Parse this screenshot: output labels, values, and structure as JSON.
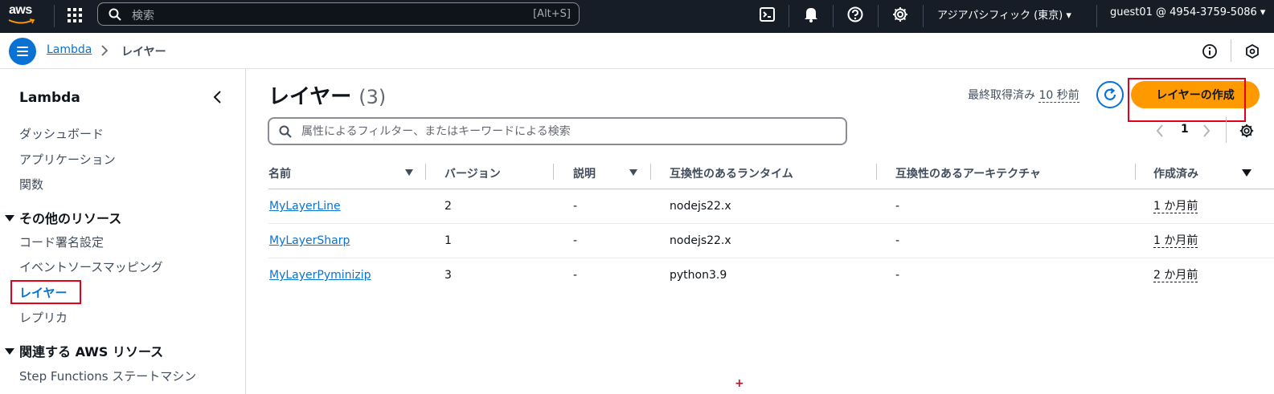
{
  "topnav": {
    "logo_text": "aws",
    "search_placeholder": "検索",
    "search_shortcut": "[Alt+S]",
    "region": "アジアパシフィック (東京) ▾",
    "account": "guest01 @ 4954-3759-5086 ▾"
  },
  "breadcrumb": {
    "service": "Lambda",
    "current": "レイヤー"
  },
  "sidebar": {
    "title": "Lambda",
    "items": [
      "ダッシュボード",
      "アプリケーション",
      "関数"
    ],
    "section_other": "その他のリソース",
    "other_items": [
      "コード署名設定",
      "イベントソースマッピング",
      "レイヤー",
      "レプリカ"
    ],
    "section_related": "関連する AWS リソース",
    "related_items": [
      "Step Functions ステートマシン"
    ]
  },
  "main": {
    "title": "レイヤー",
    "count": "(3)",
    "last_fetch_label": "最終取得済み",
    "last_fetch_value": "10 秒前",
    "create_button": "レイヤーの作成",
    "filter_placeholder": "属性によるフィルター、またはキーワードによる検索",
    "page": "1"
  },
  "table": {
    "headers": [
      "名前",
      "バージョン",
      "説明",
      "互換性のあるランタイム",
      "互換性のあるアーキテクチャ",
      "作成済み"
    ],
    "rows": [
      {
        "name": "MyLayerLine",
        "version": "2",
        "desc": "-",
        "runtime": "nodejs22.x",
        "arch": "-",
        "created": "1 か月前"
      },
      {
        "name": "MyLayerSharp",
        "version": "1",
        "desc": "-",
        "runtime": "nodejs22.x",
        "arch": "-",
        "created": "1 か月前"
      },
      {
        "name": "MyLayerPyminizip",
        "version": "3",
        "desc": "-",
        "runtime": "python3.9",
        "arch": "-",
        "created": "2 か月前"
      }
    ]
  },
  "colors": {
    "nav_bg": "#161d26",
    "link": "#0972d3",
    "primary_button": "#ff9900",
    "highlight_box": "#e3001b"
  }
}
